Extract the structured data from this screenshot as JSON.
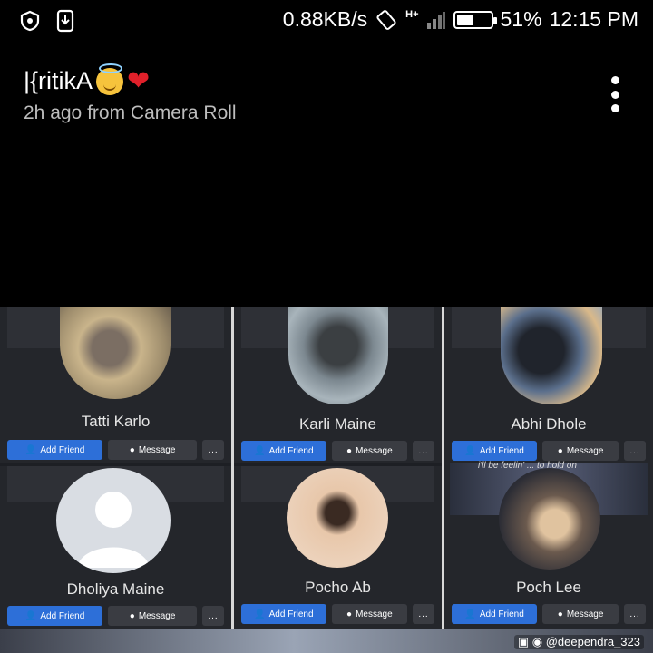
{
  "status_bar": {
    "speed": "0.88KB/s",
    "network": "H+",
    "battery_percent": "51%",
    "battery_level": 0.51,
    "time": "12:15 PM",
    "icons": [
      "shield-icon",
      "download-icon",
      "rotate-icon",
      "signal-icon",
      "battery-icon"
    ]
  },
  "header": {
    "title": "|{ritikA",
    "title_emoji": [
      "smiling-face-with-halo",
      "red-heart"
    ],
    "subtitle": "2h ago from Camera Roll",
    "menu_icon": "more-vertical-icon"
  },
  "photo": {
    "cards": [
      {
        "name": "Tatti Karlo",
        "add_label": "Add Friend",
        "message_label": "Message",
        "more_label": "..."
      },
      {
        "name": "Karli Maine",
        "add_label": "Add Friend",
        "message_label": "Message",
        "more_label": "..."
      },
      {
        "name": "Abhi Dhole",
        "add_label": "Add Friend",
        "message_label": "Message",
        "more_label": "..."
      },
      {
        "name": "Dholiya Maine",
        "add_label": "Add Friend",
        "message_label": "Message",
        "more_label": "..."
      },
      {
        "name": "Pocho Ab",
        "add_label": "Add Friend",
        "message_label": "Message",
        "more_label": "..."
      },
      {
        "name": "Poch Lee",
        "add_label": "Add Friend",
        "message_label": "Message",
        "more_label": "..."
      }
    ],
    "overlay_caption": "i'll be feelin' ... to hold on",
    "watermark": "@deependra_323"
  },
  "colors": {
    "background": "#000000",
    "card": "#24262b",
    "add_button": "#2d6fd8",
    "secondary_button": "#3a3c42",
    "heart": "#e0202a",
    "subtitle": "#bdbdbd"
  }
}
